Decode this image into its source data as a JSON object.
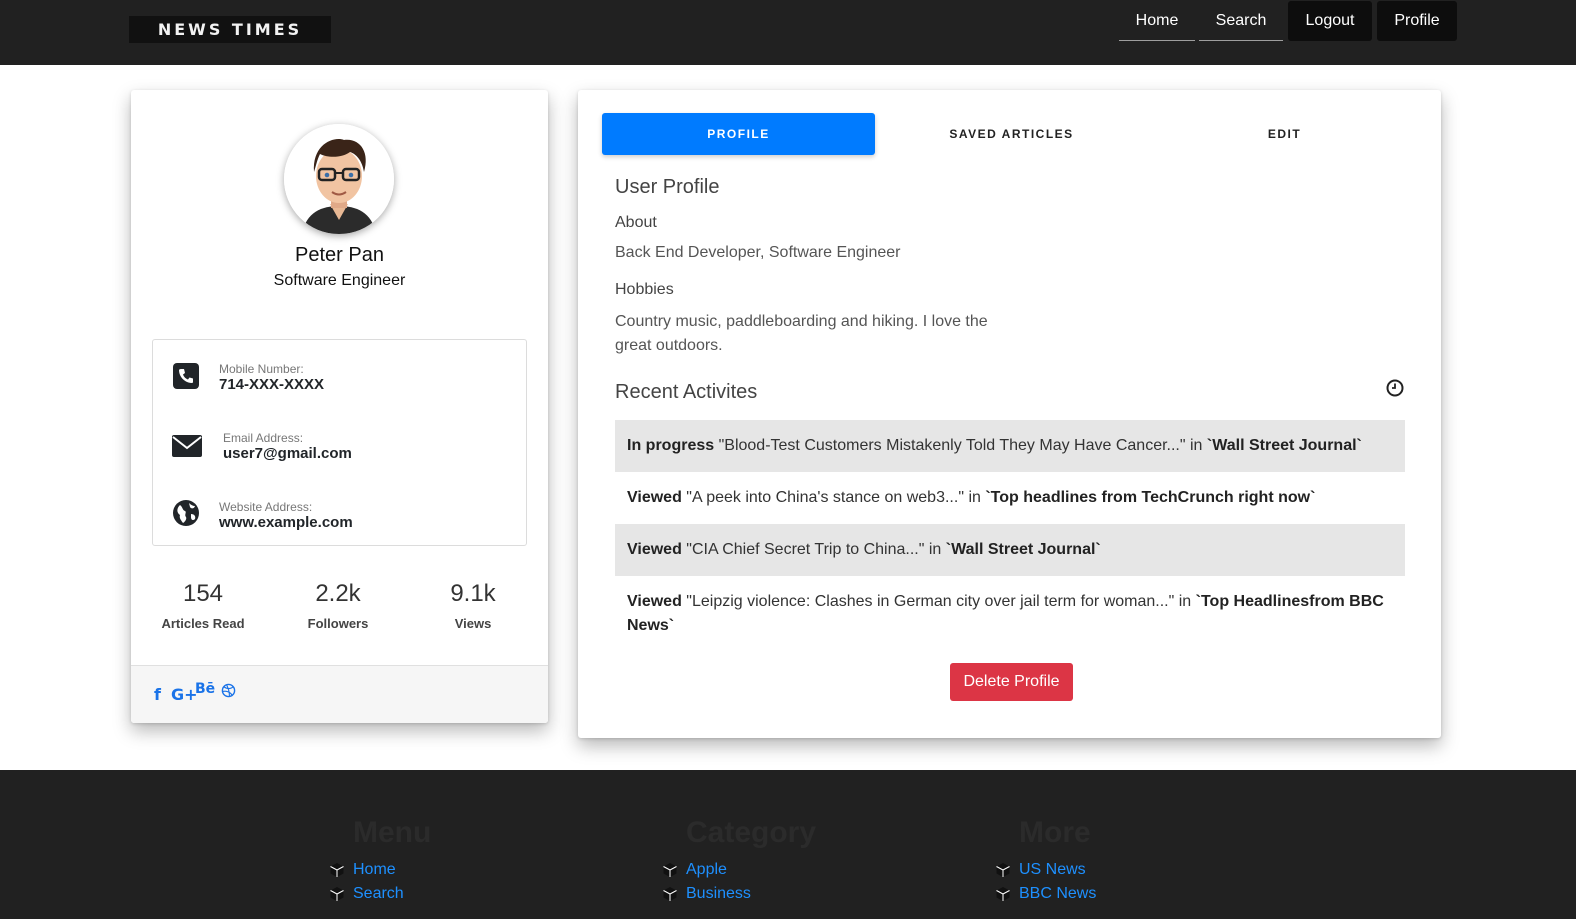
{
  "brand": "NEWS TIMES",
  "nav": {
    "home": "Home",
    "search": "Search",
    "logout": "Logout",
    "profile": "Profile"
  },
  "user": {
    "name": "Peter Pan",
    "title": "Software Engineer",
    "contact": [
      {
        "icon": "phone-icon",
        "label": "Mobile Number:",
        "value": "714-XXX-XXXX"
      },
      {
        "icon": "envelope-icon",
        "label": "Email Address:",
        "value": "user7@gmail.com"
      },
      {
        "icon": "globe-icon",
        "label": "Website Address:",
        "value": "www.example.com"
      }
    ],
    "stats": [
      {
        "value": "154",
        "label": "Articles Read"
      },
      {
        "value": "2.2k",
        "label": "Followers"
      },
      {
        "value": "9.1k",
        "label": "Views"
      }
    ],
    "social": [
      "facebook-icon",
      "google-plus-icon",
      "behance-icon",
      "dribbble-icon"
    ]
  },
  "tabs": {
    "profile": "PROFILE",
    "saved": "SAVED ARTICLES",
    "edit": "EDIT"
  },
  "profile": {
    "heading": "User Profile",
    "about_heading": "About",
    "about": "Back End Developer, Software Engineer",
    "hobbies_heading": "Hobbies",
    "hobbies": "Country music, paddleboarding and hiking. I love the great outdoors.",
    "recent_heading": "Recent Activites"
  },
  "activities": [
    {
      "status": "In progress",
      "title": "\"Blood-Test Customers Mistakenly Told They May Have Cancer...\"",
      "in": " in ",
      "source": "`Wall Street Journal`"
    },
    {
      "status": "Viewed",
      "title": "\"A peek into China's stance on web3...\"",
      "in": " in ",
      "source": "`Top headlines from TechCrunch right now`"
    },
    {
      "status": "Viewed",
      "title": "\"CIA Chief Secret Trip to China...\"",
      "in": " in ",
      "source": "`Wall Street Journal`"
    },
    {
      "status": "Viewed",
      "title": "\"Leipzig violence: Clashes in German city over jail term for woman...\"",
      "in": " in ",
      "source": "`Top Headlinesfrom BBC News`"
    }
  ],
  "delete_label": "Delete Profile",
  "footer": {
    "menu": {
      "heading": "Menu",
      "links": [
        "Home",
        "Search"
      ]
    },
    "category": {
      "heading": "Category",
      "links": [
        "Apple",
        "Business"
      ]
    },
    "more": {
      "heading": "More",
      "links": [
        "US News",
        "BBC News"
      ]
    }
  },
  "colors": {
    "accent": "#007bff",
    "danger": "#dc3545",
    "navbar": "#212121",
    "link": "#1e90ff"
  }
}
